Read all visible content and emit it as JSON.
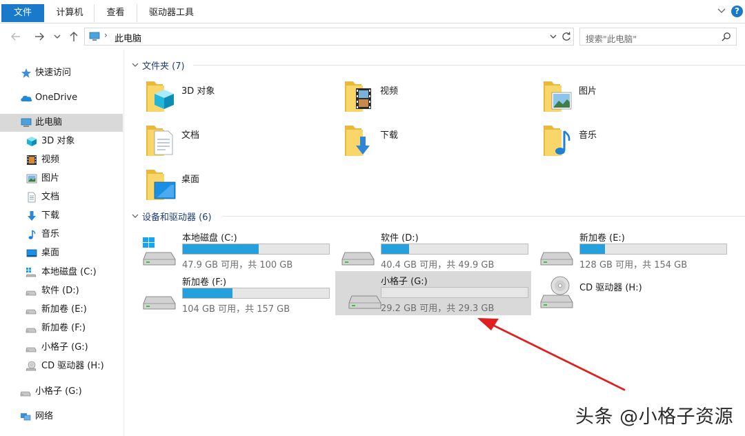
{
  "ribbon": {
    "tabs": [
      {
        "label": "文件",
        "active": true
      },
      {
        "label": "计算机",
        "active": false
      },
      {
        "label": "查看",
        "active": false
      },
      {
        "label": "驱动器工具",
        "active": false
      }
    ],
    "help_label": "?"
  },
  "address": {
    "path": "此电脑",
    "separator": "›",
    "search_placeholder": "搜索\"此电脑\""
  },
  "sidebar": {
    "items": [
      {
        "label": "快速访问",
        "icon": "star-icon"
      },
      {
        "label": "OneDrive",
        "icon": "cloud-icon"
      },
      {
        "label": "此电脑",
        "icon": "computer-icon",
        "selected": true
      },
      {
        "label": "3D 对象",
        "icon": "cube-icon"
      },
      {
        "label": "视频",
        "icon": "film-icon"
      },
      {
        "label": "图片",
        "icon": "picture-icon"
      },
      {
        "label": "文档",
        "icon": "document-icon"
      },
      {
        "label": "下载",
        "icon": "download-arrow-icon"
      },
      {
        "label": "音乐",
        "icon": "music-note-icon"
      },
      {
        "label": "桌面",
        "icon": "desktop-icon"
      },
      {
        "label": "本地磁盘 (C:)",
        "icon": "system-drive-icon"
      },
      {
        "label": "软件 (D:)",
        "icon": "drive-icon"
      },
      {
        "label": "新加卷 (E:)",
        "icon": "drive-icon"
      },
      {
        "label": "新加卷 (F:)",
        "icon": "drive-icon"
      },
      {
        "label": "小格子 (G:)",
        "icon": "drive-icon"
      },
      {
        "label": "CD 驱动器 (H:)",
        "icon": "cd-drive-icon"
      },
      {
        "label": "小格子 (G:)",
        "icon": "drive-icon"
      },
      {
        "label": "网络",
        "icon": "network-icon"
      }
    ]
  },
  "folders": {
    "header": "文件夹 (7)",
    "items": [
      {
        "label": "3D 对象",
        "icon": "folder-3d-objects-icon"
      },
      {
        "label": "视频",
        "icon": "folder-videos-icon"
      },
      {
        "label": "图片",
        "icon": "folder-pictures-icon"
      },
      {
        "label": "文档",
        "icon": "folder-documents-icon"
      },
      {
        "label": "下载",
        "icon": "folder-downloads-icon"
      },
      {
        "label": "音乐",
        "icon": "folder-music-icon"
      },
      {
        "label": "桌面",
        "icon": "folder-desktop-icon"
      }
    ]
  },
  "drives": {
    "header": "设备和驱动器 (6)",
    "items": [
      {
        "label": "本地磁盘 (C:)",
        "info": "47.9 GB 可用，共 100 GB",
        "used_fraction": 0.521,
        "icon": "system-drive-icon",
        "has_bar": true
      },
      {
        "label": "软件 (D:)",
        "info": "40.4 GB 可用，共 49.9 GB",
        "used_fraction": 0.19,
        "icon": "drive-icon",
        "has_bar": true
      },
      {
        "label": "新加卷 (E:)",
        "info": "128 GB 可用，共 154 GB",
        "used_fraction": 0.169,
        "icon": "drive-icon",
        "has_bar": true
      },
      {
        "label": "新加卷 (F:)",
        "info": "104 GB 可用，共 157 GB",
        "used_fraction": 0.338,
        "icon": "drive-icon",
        "has_bar": true
      },
      {
        "label": "小格子 (G:)",
        "info": "29.2 GB 可用，共 29.3 GB",
        "used_fraction": 0.0,
        "icon": "drive-icon",
        "has_bar": true,
        "selected": true
      },
      {
        "label": "CD 驱动器 (H:)",
        "info": "",
        "used_fraction": 0.0,
        "icon": "cd-drive-icon",
        "has_bar": false
      }
    ]
  },
  "watermark": "头条 @小格子资源",
  "colors": {
    "accent": "#1979ca",
    "bar_fill": "#26a0da",
    "selection": "#d9d9d9",
    "annotation_arrow": "#e02020",
    "folder_yellow": "#f8d66a"
  }
}
